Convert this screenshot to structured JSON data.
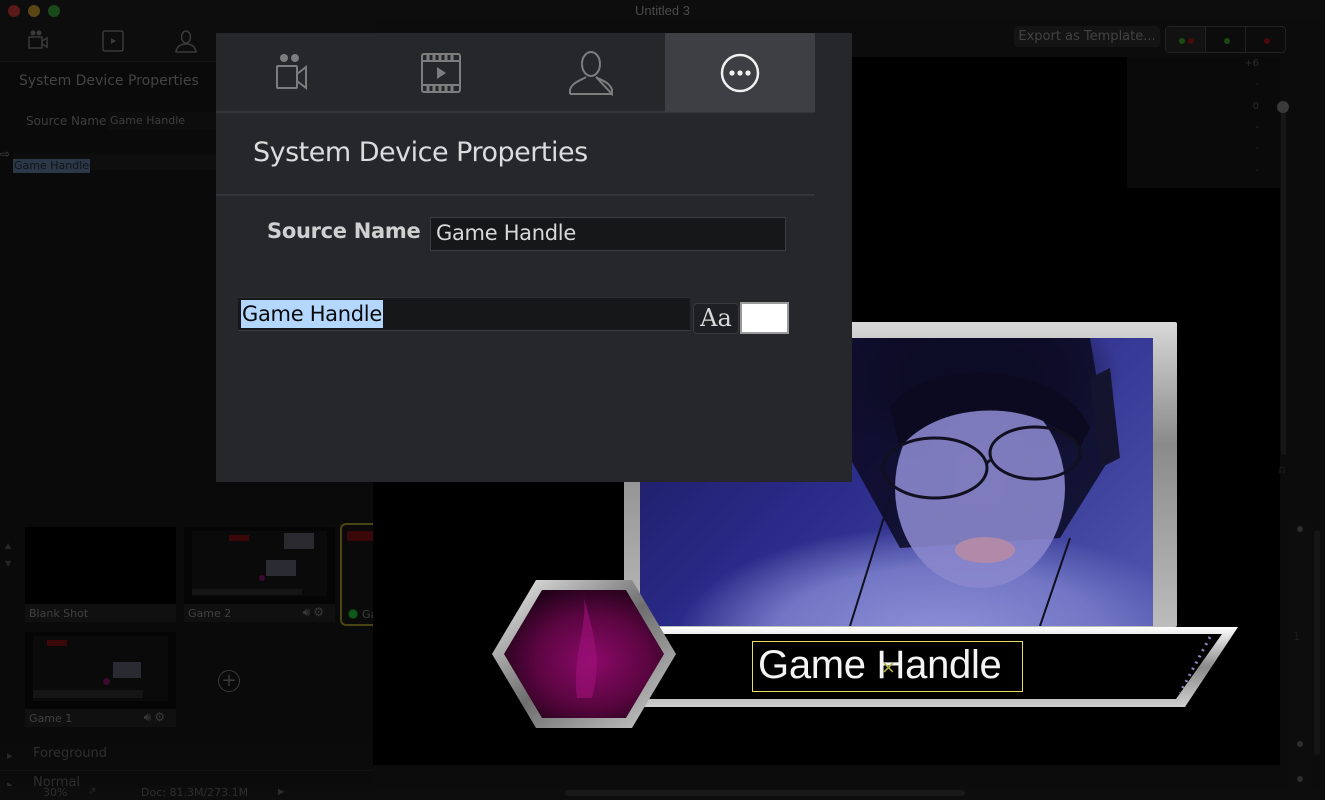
{
  "window": {
    "title": "Untitled 3"
  },
  "background_panel": {
    "heading": "System Device Properties",
    "source_name_label": "Source Name",
    "source_name_value": "Game Handle",
    "text_value": "Game Handle"
  },
  "popover": {
    "tabs": [
      {
        "name": "sources",
        "icon": "video-camera-icon",
        "active": false
      },
      {
        "name": "media",
        "icon": "film-play-icon",
        "active": false
      },
      {
        "name": "person",
        "icon": "person-icon",
        "active": false
      },
      {
        "name": "more",
        "icon": "ellipsis-circle-icon",
        "active": true
      }
    ],
    "title": "System Device Properties",
    "source_name_label": "Source Name",
    "source_name_value": "Game Handle",
    "text_value": "Game Handle",
    "font_button_label": "Aa",
    "text_color": "#ffffff"
  },
  "toolbar": {
    "export_label": "Export as Template...",
    "segments": [
      {
        "name": "both",
        "dots": [
          "green",
          "red"
        ]
      },
      {
        "name": "green",
        "dots": [
          "green"
        ]
      },
      {
        "name": "red",
        "dots": [
          "red"
        ]
      }
    ]
  },
  "audio": {
    "ticks": [
      "+6",
      "-",
      "0",
      "-",
      "-",
      "-"
    ],
    "level_db": 0
  },
  "shots": [
    {
      "label": "Blank Shot",
      "has_controls": false,
      "live": false
    },
    {
      "label": "Game 2",
      "has_controls": true,
      "live": false
    },
    {
      "label": "Ga",
      "has_controls": false,
      "live": true
    },
    {
      "label": "Game 1",
      "has_controls": true,
      "live": false
    }
  ],
  "add_shot_label": "+",
  "layers": [
    {
      "name": "Foreground"
    },
    {
      "name": "Normal"
    }
  ],
  "canvas": {
    "lower_third_text": "Game Handle"
  },
  "statusbar": {
    "zoom": "30%",
    "doc": "Doc: 81.3M/273.1M"
  },
  "right_strip": {
    "number": "1"
  },
  "colors": {
    "accent_selection": "#b3d7ff",
    "live_border": "#e8df5a",
    "popover_bg": "#26272b"
  }
}
